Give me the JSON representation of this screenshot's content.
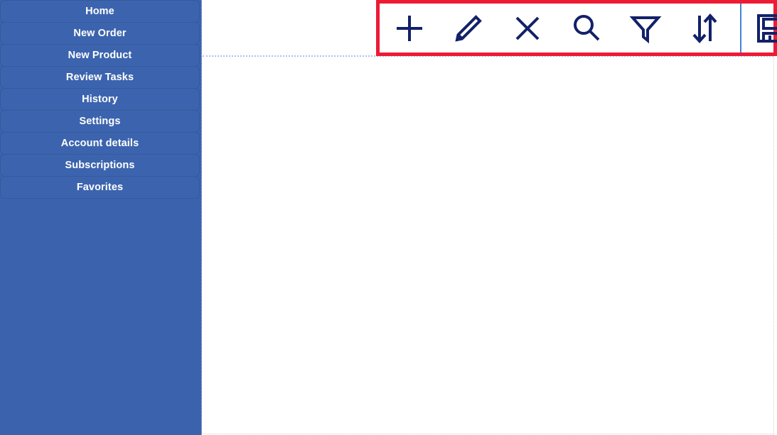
{
  "sidebar": {
    "items": [
      {
        "label": "Home",
        "name": "sidebar-item-home"
      },
      {
        "label": "New Order",
        "name": "sidebar-item-new-order"
      },
      {
        "label": "New Product",
        "name": "sidebar-item-new-product"
      },
      {
        "label": "Review Tasks",
        "name": "sidebar-item-review-tasks"
      },
      {
        "label": "History",
        "name": "sidebar-item-history"
      },
      {
        "label": "Settings",
        "name": "sidebar-item-settings"
      },
      {
        "label": "Account details",
        "name": "sidebar-item-account-details"
      },
      {
        "label": "Subscriptions",
        "name": "sidebar-item-subscriptions"
      },
      {
        "label": "Favorites",
        "name": "sidebar-item-favorites"
      }
    ],
    "background_color": "#3c64ae",
    "text_color": "#ffffff"
  },
  "toolbar": {
    "highlight_color": "#ed1b34",
    "icon_color": "#122169",
    "divider_color": "#3c86d8",
    "buttons": [
      {
        "icon": "plus-icon",
        "label": "Add"
      },
      {
        "icon": "pencil-icon",
        "label": "Edit"
      },
      {
        "icon": "close-x-icon",
        "label": "Delete"
      },
      {
        "icon": "search-icon",
        "label": "Search"
      },
      {
        "icon": "filter-funnel-icon",
        "label": "Filter"
      },
      {
        "icon": "sort-arrows-icon",
        "label": "Sort"
      }
    ],
    "end_buttons": [
      {
        "icon": "save-floppy-icon",
        "label": "Save"
      }
    ]
  },
  "content": {
    "body_text": "",
    "background_color": "#ffffff"
  }
}
